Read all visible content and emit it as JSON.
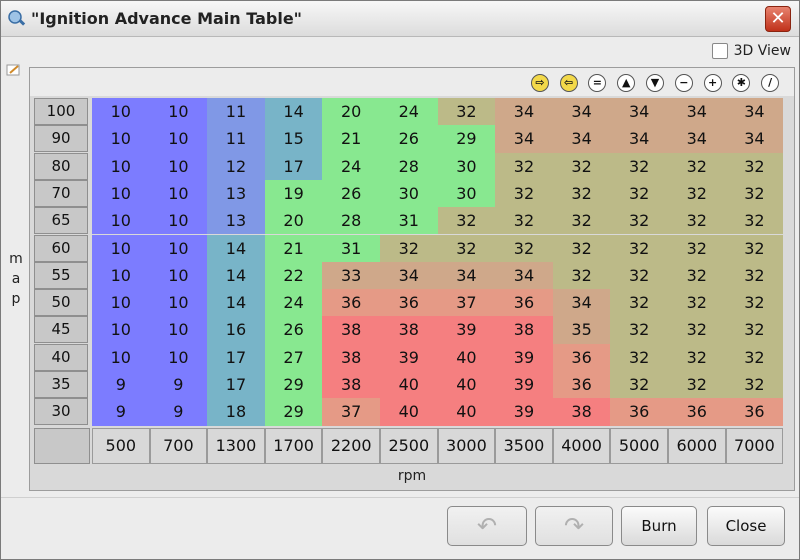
{
  "window": {
    "title": "\"Ignition Advance Main Table\"",
    "close_glyph": "✕"
  },
  "options": {
    "view3d_label": "3D View",
    "view3d_checked": false
  },
  "axes": {
    "y_label_letters": [
      "m",
      "a",
      "p"
    ],
    "x_label": "rpm"
  },
  "toolbar": {
    "buttons": [
      {
        "icon": "arrow-right-icon",
        "glyph": "⇨",
        "color": "#f3d94a"
      },
      {
        "icon": "arrow-left-icon",
        "glyph": "⇦",
        "color": "#f3d94a"
      },
      {
        "icon": "equals-icon",
        "glyph": "="
      },
      {
        "icon": "up-triangle-icon",
        "glyph": "▲"
      },
      {
        "icon": "down-triangle-icon",
        "glyph": "▼"
      },
      {
        "icon": "minus-icon",
        "glyph": "−"
      },
      {
        "icon": "plus-icon",
        "glyph": "+"
      },
      {
        "icon": "asterisk-icon",
        "glyph": "✱"
      },
      {
        "icon": "color-pen-icon",
        "glyph": "/"
      }
    ]
  },
  "table": {
    "row_headers": [
      "100",
      "90",
      "80",
      "70",
      "65",
      "60",
      "55",
      "50",
      "45",
      "40",
      "35",
      "30"
    ],
    "col_headers": [
      "500",
      "700",
      "1300",
      "1700",
      "2200",
      "2500",
      "3000",
      "3500",
      "4000",
      "5000",
      "6000",
      "7000"
    ],
    "values": [
      [
        10,
        10,
        11,
        14,
        20,
        24,
        32,
        34,
        34,
        34,
        34,
        34
      ],
      [
        10,
        10,
        11,
        15,
        21,
        26,
        29,
        34,
        34,
        34,
        34,
        34
      ],
      [
        10,
        10,
        12,
        17,
        24,
        28,
        30,
        32,
        32,
        32,
        32,
        32
      ],
      [
        10,
        10,
        13,
        19,
        26,
        30,
        30,
        32,
        32,
        32,
        32,
        32
      ],
      [
        10,
        10,
        13,
        20,
        28,
        31,
        32,
        32,
        32,
        32,
        32,
        32
      ],
      [
        10,
        10,
        14,
        21,
        31,
        32,
        32,
        32,
        32,
        32,
        32,
        32
      ],
      [
        10,
        10,
        14,
        22,
        33,
        34,
        34,
        34,
        32,
        32,
        32,
        32
      ],
      [
        10,
        10,
        14,
        24,
        36,
        36,
        37,
        36,
        34,
        32,
        32,
        32
      ],
      [
        10,
        10,
        16,
        26,
        38,
        38,
        39,
        38,
        35,
        32,
        32,
        32
      ],
      [
        10,
        10,
        17,
        27,
        38,
        39,
        40,
        39,
        36,
        32,
        32,
        32
      ],
      [
        9,
        9,
        17,
        29,
        38,
        40,
        40,
        39,
        36,
        32,
        32,
        32
      ],
      [
        9,
        9,
        18,
        29,
        37,
        40,
        40,
        39,
        38,
        36,
        36,
        36
      ]
    ],
    "colors": {
      "low": "#7c7cff",
      "blue_mid": "#8098e6",
      "teal": "#78b4c8",
      "green": "#88e890",
      "olive": "#bcba88",
      "tan": "#cfa88a",
      "salmon": "#e59a86",
      "red": "#f57f80"
    }
  },
  "buttons": {
    "undo_glyph": "↶",
    "redo_glyph": "↷",
    "burn_label": "Burn",
    "close_label": "Close"
  }
}
